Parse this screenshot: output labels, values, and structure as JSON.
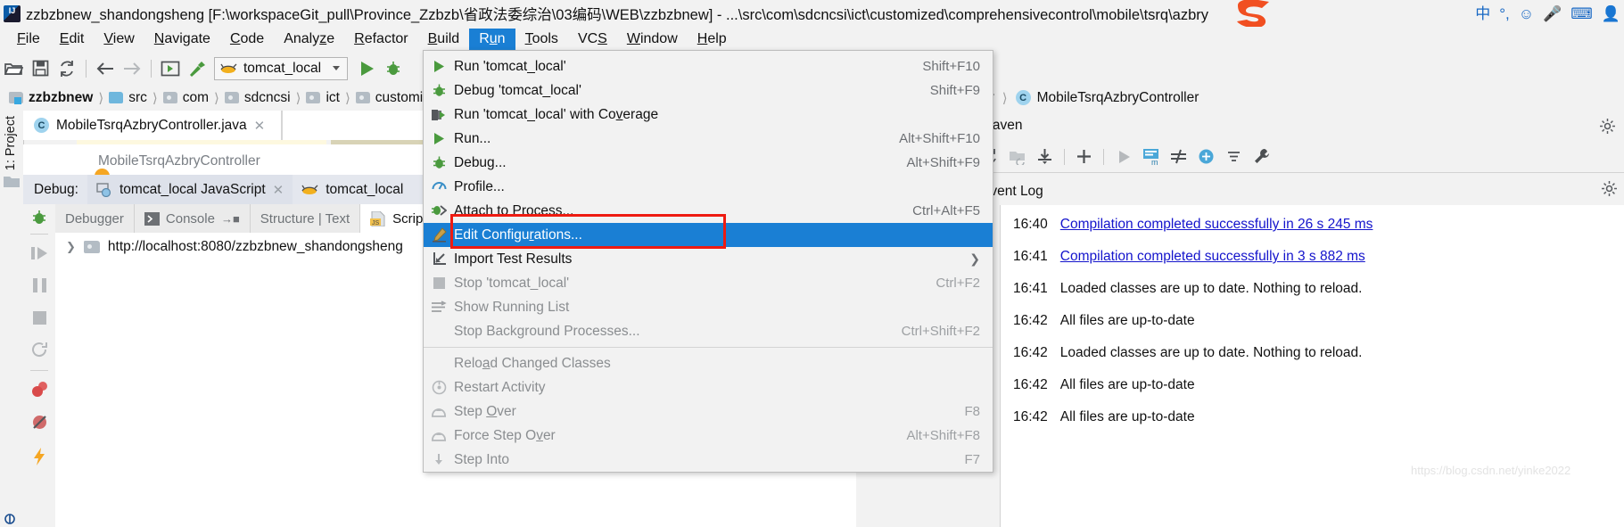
{
  "window": {
    "title": "zzbzbnew_shandongsheng [F:\\workspaceGit_pull\\Province_Zzbzb\\省政法委综治\\03编码\\WEB\\zzbzbnew] - ...\\src\\com\\sdcncsi\\ict\\customized\\comprehensivecontrol\\mobile\\tsrq\\azbry",
    "tray": [
      "中",
      "°,",
      "☺",
      "🎤",
      "⌨",
      "👤"
    ]
  },
  "menubar": {
    "items": [
      {
        "label": "File",
        "mnemonic": "F"
      },
      {
        "label": "Edit",
        "mnemonic": "E"
      },
      {
        "label": "View",
        "mnemonic": "V"
      },
      {
        "label": "Navigate",
        "mnemonic": "N"
      },
      {
        "label": "Code",
        "mnemonic": "C"
      },
      {
        "label": "Analyze",
        "mnemonic": "z"
      },
      {
        "label": "Refactor",
        "mnemonic": "R"
      },
      {
        "label": "Build",
        "mnemonic": "B"
      },
      {
        "label": "Run",
        "mnemonic": "u",
        "active": true
      },
      {
        "label": "Tools",
        "mnemonic": "T"
      },
      {
        "label": "VCS",
        "mnemonic": "S"
      },
      {
        "label": "Window",
        "mnemonic": "W"
      },
      {
        "label": "Help",
        "mnemonic": "H"
      }
    ]
  },
  "toolbar": {
    "icons": [
      "open-folder-icon",
      "save-icon",
      "sync-icon",
      "back-arrow-icon",
      "forward-arrow-icon",
      "run-config-icon",
      "build-hammer-icon"
    ],
    "run_config": "tomcat_local",
    "run_button": "run-icon",
    "debug_button": "debug-icon"
  },
  "breadcrumb": {
    "items": [
      "zzbzbnew",
      "src",
      "com",
      "sdcncsi",
      "ict",
      "customized"
    ],
    "right_items": [
      "y",
      "MobileTsrqAzbryController"
    ]
  },
  "editor": {
    "tab_label": "MobileTsrqAzbryController.java",
    "class_label": "MobileTsrqAzbryController"
  },
  "debug_panel": {
    "label": "Debug:",
    "tabs": [
      {
        "label": "tomcat_local JavaScript",
        "selected": true
      },
      {
        "label": "tomcat_local",
        "selected": false
      }
    ],
    "inner_tabs": [
      {
        "label": "Debugger",
        "selected": false
      },
      {
        "label": "Console",
        "selected": false
      },
      {
        "label": "Structure | Text",
        "selected": false
      },
      {
        "label": "Scripts",
        "selected": true
      }
    ],
    "tree_root": "http://localhost:8080/zzbzbnew_shandongsheng",
    "side_icons": [
      "debug-bug-icon",
      "resume-icon",
      "pause-icon",
      "stop-icon",
      "restart-icon",
      "mute-breakpoints-icon",
      "view-breakpoints-icon",
      "evaluate-icon"
    ]
  },
  "maven": {
    "title": "Maven",
    "tool_icons": [
      "reimport-icon",
      "generate-sources-icon",
      "download-sources-icon",
      "add-icon",
      "run-icon",
      "execute-maven-goal-icon",
      "toggle-offline-icon",
      "show-dependencies-icon",
      "collapse-all-icon",
      "settings-wrench-icon"
    ]
  },
  "event_log": {
    "title": "Event Log",
    "side_icons": [
      "mark-read-icon",
      "delete-icon",
      "settings-wrench-icon"
    ],
    "entries": [
      {
        "time": "16:40",
        "message": "Compilation completed successfully in 26 s 245 ms",
        "link": true
      },
      {
        "time": "16:41",
        "message": "Compilation completed successfully in 3 s 882 ms",
        "link": true
      },
      {
        "time": "16:41",
        "message": "Loaded classes are up to date. Nothing to reload.",
        "link": false
      },
      {
        "time": "16:42",
        "message": "All files are up-to-date",
        "link": false
      },
      {
        "time": "16:42",
        "message": "Loaded classes are up to date. Nothing to reload.",
        "link": false
      },
      {
        "time": "16:42",
        "message": "All files are up-to-date",
        "link": false
      },
      {
        "time": "16:42",
        "message": "All files are up-to-date",
        "link": false
      }
    ]
  },
  "run_menu": {
    "items": [
      {
        "label": "Run 'tomcat_local'",
        "shortcut": "Shift+F10",
        "icon": "run-green-icon",
        "disabled": false,
        "selected": false,
        "submenu": false
      },
      {
        "label": "Debug 'tomcat_local'",
        "shortcut": "Shift+F9",
        "icon": "debug-bug-icon",
        "disabled": false,
        "selected": false,
        "submenu": false
      },
      {
        "label": "Run 'tomcat_local' with Coverage",
        "shortcut": "",
        "icon": "coverage-icon",
        "disabled": false,
        "selected": false,
        "submenu": false
      },
      {
        "label": "Run...",
        "shortcut": "Alt+Shift+F10",
        "icon": "run-green-icon",
        "disabled": false,
        "selected": false,
        "submenu": false
      },
      {
        "label": "Debug...",
        "shortcut": "Alt+Shift+F9",
        "icon": "debug-bug-icon",
        "disabled": false,
        "selected": false,
        "submenu": false
      },
      {
        "label": "Profile...",
        "shortcut": "",
        "icon": "profile-icon",
        "disabled": false,
        "selected": false,
        "submenu": false
      },
      {
        "label": "Attach to Process...",
        "shortcut": "Ctrl+Alt+F5",
        "icon": "attach-process-icon",
        "disabled": false,
        "selected": false,
        "submenu": false
      },
      {
        "label": "Edit Configurations...",
        "shortcut": "",
        "icon": "edit-pencil-icon",
        "disabled": false,
        "selected": true,
        "submenu": false
      },
      {
        "label": "Import Test Results",
        "shortcut": "",
        "icon": "import-tests-icon",
        "disabled": false,
        "selected": false,
        "submenu": true
      },
      {
        "label": "Stop 'tomcat_local'",
        "shortcut": "Ctrl+F2",
        "icon": "stop-square-icon",
        "disabled": true,
        "selected": false,
        "submenu": false
      },
      {
        "label": "Show Running List",
        "shortcut": "",
        "icon": "running-list-icon",
        "disabled": true,
        "selected": false,
        "submenu": false
      },
      {
        "label": "Stop Background Processes...",
        "shortcut": "Ctrl+Shift+F2",
        "icon": "",
        "disabled": true,
        "selected": false,
        "submenu": false
      },
      {
        "separator": true
      },
      {
        "label": "Reload Changed Classes",
        "shortcut": "",
        "icon": "",
        "disabled": true,
        "selected": false,
        "submenu": false
      },
      {
        "label": "Restart Activity",
        "shortcut": "",
        "icon": "restart-activity-icon",
        "disabled": true,
        "selected": false,
        "submenu": false
      },
      {
        "label": "Step Over",
        "shortcut": "F8",
        "icon": "step-over-icon",
        "disabled": true,
        "selected": false,
        "submenu": false
      },
      {
        "label": "Force Step Over",
        "shortcut": "Alt+Shift+F8",
        "icon": "step-over-icon",
        "disabled": true,
        "selected": false,
        "submenu": false
      },
      {
        "label": "Step Into",
        "shortcut": "F7",
        "icon": "step-into-icon",
        "disabled": true,
        "selected": false,
        "submenu": false
      }
    ],
    "highlight_color": "#1a7fd4",
    "annotation_color": "#ee1b11"
  },
  "watermark": "https://blog.csdn.net/yinke2022"
}
